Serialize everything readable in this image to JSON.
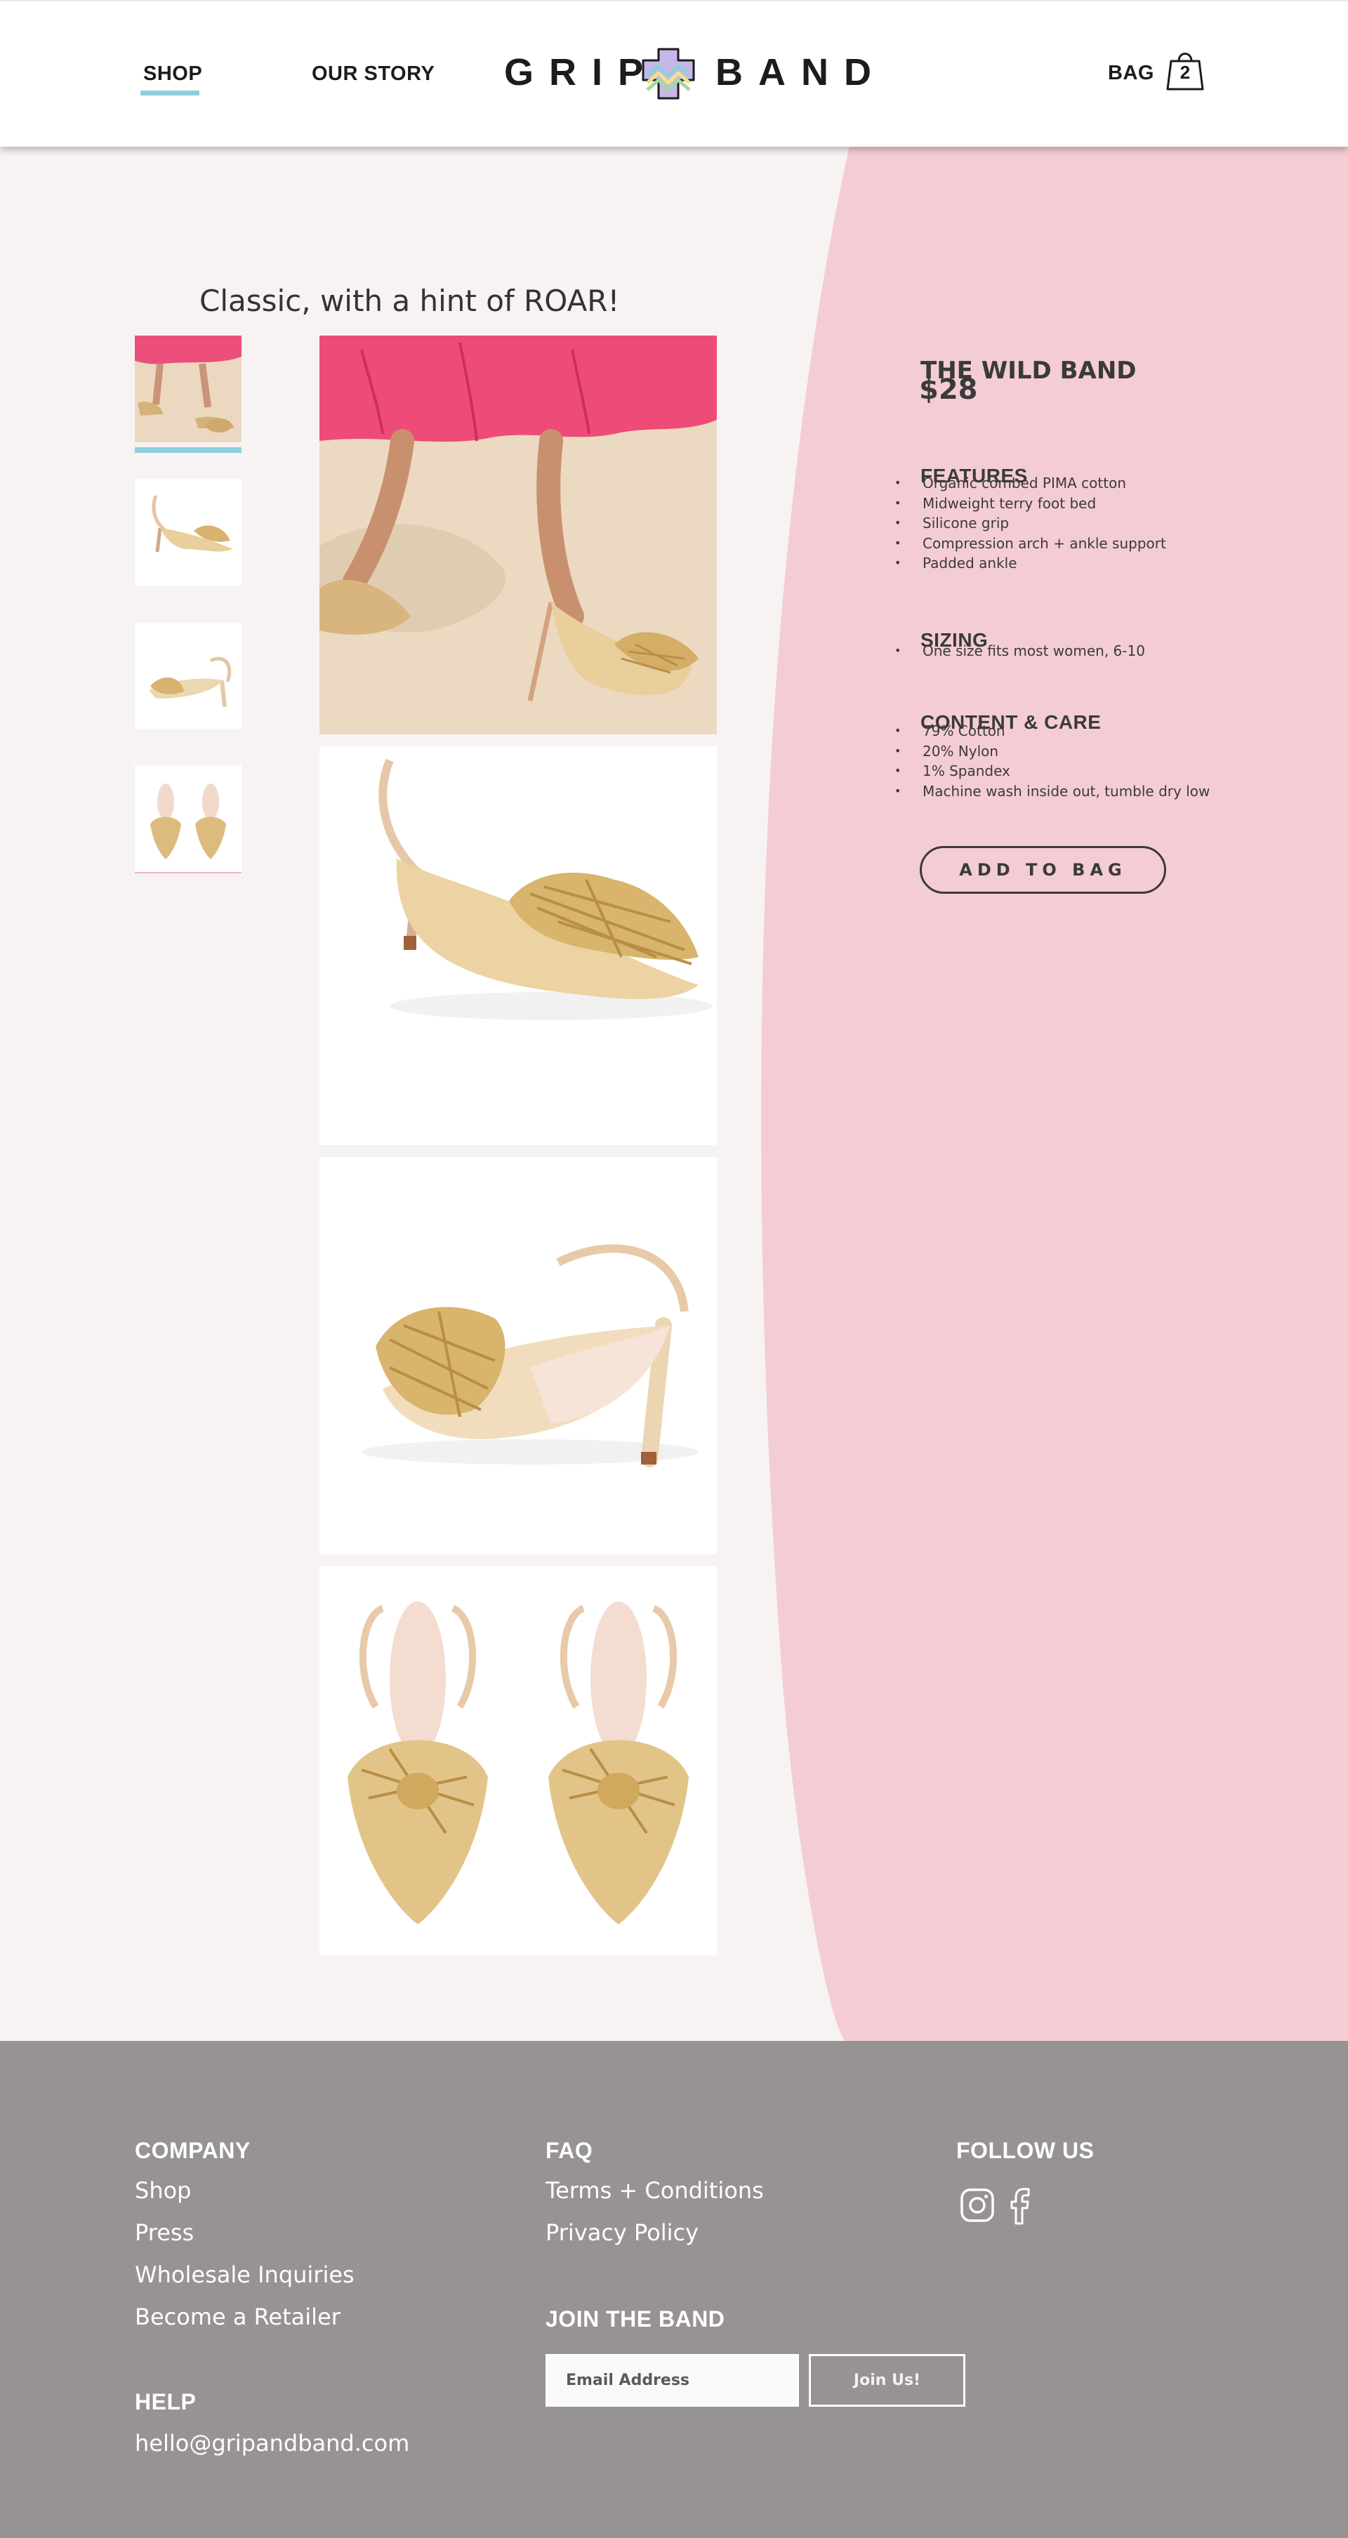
{
  "header": {
    "nav": {
      "shop": "SHOP",
      "our_story": "OUR STORY",
      "bag": "BAG"
    },
    "logo": {
      "left_word": "GRIP",
      "right_word": "BAND"
    },
    "bag_count": "2"
  },
  "tagline": "Classic, with a hint of ROAR!",
  "gallery": {
    "thumbnails": [
      "model-feet-photo",
      "shoe-side-photo",
      "shoe-back-photo",
      "shoe-pair-top-photo"
    ],
    "images": [
      "model-feet-photo",
      "shoe-side-photo",
      "shoe-back-photo",
      "shoe-pair-top-photo"
    ],
    "selected_thumbnail": 1
  },
  "product": {
    "name": "THE WILD BAND",
    "price": "$28",
    "features_heading": "FEATURES",
    "features": [
      "Organic combed PIMA cotton",
      "Midweight terry foot bed",
      "Silicone grip",
      "Compression arch + ankle support",
      "Padded ankle"
    ],
    "sizing_heading": "SIZING",
    "sizing": [
      "One size fits most women, 6-10"
    ],
    "care_heading": "CONTENT & CARE",
    "care": [
      "79% Cotton",
      "20% Nylon",
      "1% Spandex",
      "Machine wash inside out, tumble dry low"
    ],
    "add_to_bag": "ADD TO BAG"
  },
  "footer": {
    "company_heading": "COMPANY",
    "company_links": [
      "Shop",
      "Press",
      "Wholesale Inquiries",
      "Become a Retailer"
    ],
    "help_heading": "HELP",
    "help_email": "hello@gripandband.com",
    "faq_heading": "FAQ",
    "faq_links": [
      "Terms + Conditions",
      "Privacy Policy"
    ],
    "join_heading": "JOIN THE BAND",
    "email_placeholder": "Email Address",
    "join_button": "Join Us!",
    "follow_heading": "FOLLOW US",
    "social_icons": [
      "instagram-icon",
      "facebook-icon"
    ]
  },
  "colors": {
    "page_background": "#f7f3f2",
    "pink_panel": "#f4cdd4",
    "accent_blue": "#8ecfdf",
    "footer_gray": "#979392",
    "text_dark": "#3a3a3a"
  }
}
